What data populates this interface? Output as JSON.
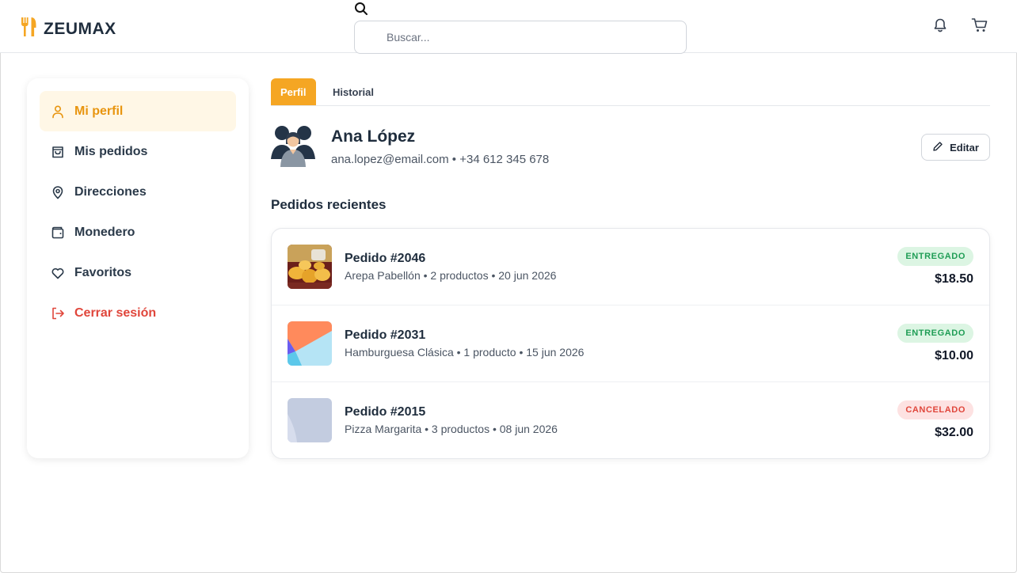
{
  "brand": {
    "name": "ZEUMAX",
    "accent": "#f5a623"
  },
  "header": {
    "search_placeholder": "Buscar...",
    "icons": [
      "search-icon",
      "bell-icon",
      "cart-icon"
    ]
  },
  "sidebar": {
    "items": [
      {
        "label": "Mi perfil",
        "icon": "user-icon",
        "active": true
      },
      {
        "label": "Mis pedidos",
        "icon": "bag-icon"
      },
      {
        "label": "Direcciones",
        "icon": "map-pin-icon"
      },
      {
        "label": "Monedero",
        "icon": "wallet-icon"
      },
      {
        "label": "Favoritos",
        "icon": "heart-icon"
      },
      {
        "label": "Cerrar sesión",
        "icon": "logout-icon",
        "danger": true
      }
    ]
  },
  "tabs": [
    {
      "label": "Perfil",
      "active": true
    },
    {
      "label": "Historial"
    }
  ],
  "profile": {
    "name": "Ana López",
    "contact": "ana.lopez@email.com • +34 612 345 678",
    "edit_label": "Editar"
  },
  "orders": {
    "title": "Pedidos recientes",
    "items": [
      {
        "title": "Pedido #2046",
        "subtitle": "Arepa Pabellón • 2 productos • 20 jun 2026",
        "status": "ENTREGADO",
        "price": "$18.50"
      },
      {
        "title": "Pedido #2031",
        "subtitle": "Hamburguesa Clásica • 1 producto • 15 jun 2026",
        "status": "ENTREGADO",
        "price": "$10.00"
      },
      {
        "title": "Pedido #2015",
        "subtitle": "Pizza Margarita • 3 productos • 08 jun 2026",
        "status": "CANCELADO",
        "price": "$32.00"
      }
    ]
  },
  "colors": {
    "delivered": "#1f9d55",
    "cancelled": "#e0463b",
    "danger": "#e0463b"
  }
}
